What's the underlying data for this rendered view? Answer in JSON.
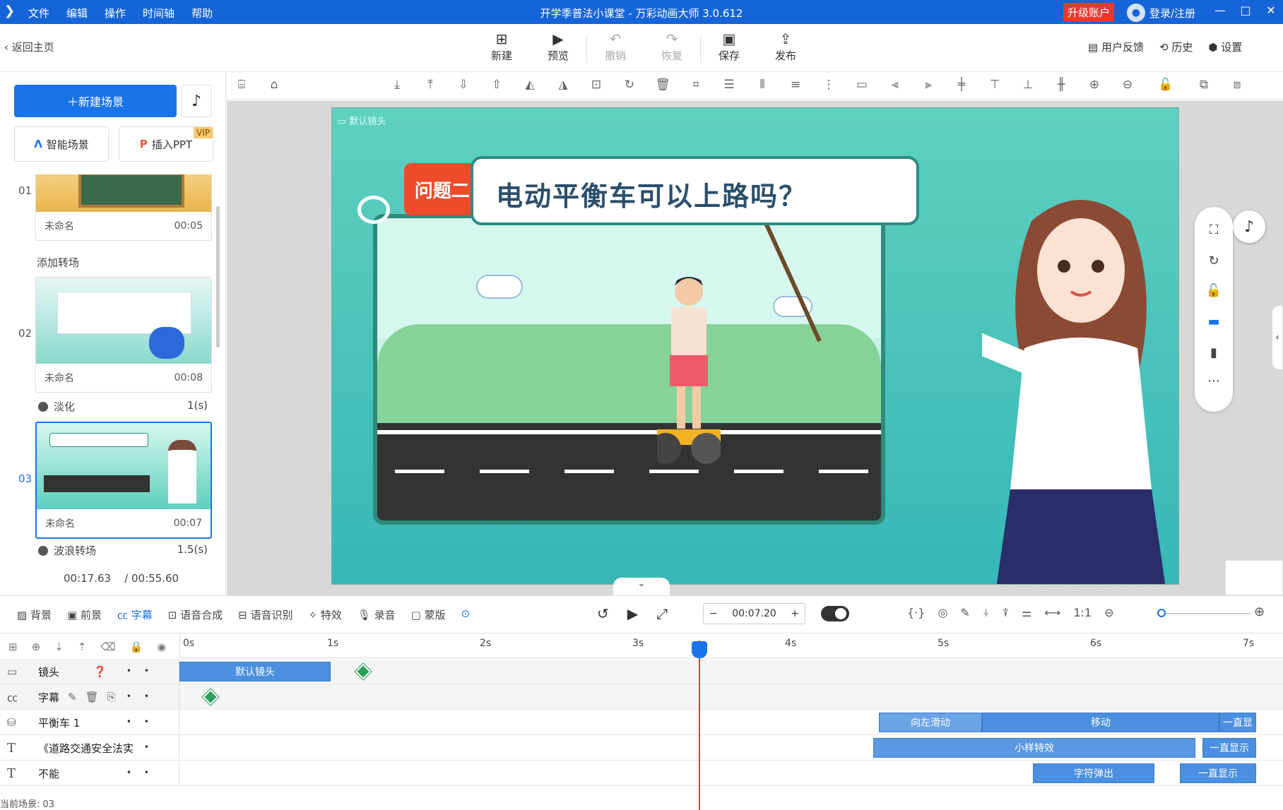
{
  "menu": [
    "文件",
    "编辑",
    "操作",
    "时间轴",
    "帮助"
  ],
  "app_title": "开学季普法小课堂 - 万彩动画大师 3.0.612",
  "upgrade": "升级账户",
  "login": "登录/注册",
  "back": "返回主页",
  "toolbar": [
    {
      "label": "新建",
      "icon": "plus-square-icon",
      "disabled": false
    },
    {
      "label": "预览",
      "icon": "play-icon",
      "disabled": false
    },
    {
      "label": "撤销",
      "icon": "undo-icon",
      "disabled": true
    },
    {
      "label": "恢复",
      "icon": "redo-icon",
      "disabled": true
    },
    {
      "label": "保存",
      "icon": "save-icon",
      "disabled": false
    },
    {
      "label": "发布",
      "icon": "publish-icon",
      "disabled": false
    }
  ],
  "right_actions": [
    "用户反馈",
    "历史",
    "设置"
  ],
  "new_scene": "新建场景",
  "smart_scene": "智能场景",
  "insert_ppt": "插入PPT",
  "vip": "VIP",
  "add_transition": "添加转场",
  "scenes": [
    {
      "num": "01",
      "name": "未命名",
      "dur": "00:05"
    },
    {
      "num": "02",
      "name": "未命名",
      "dur": "00:08"
    },
    {
      "num": "03",
      "name": "未命名",
      "dur": "00:07"
    }
  ],
  "transitions": [
    {
      "name": "淡化",
      "dur": "1(s)"
    },
    {
      "name": "波浪转场",
      "dur": "1.5(s)"
    }
  ],
  "current_time": "00:17.63",
  "total_time": "/ 00:55.60",
  "canvas": {
    "camera_label": "默认镜头",
    "badge": "问题二:",
    "question": "电动平衡车可以上路吗？"
  },
  "bottom_tabs": [
    "背景",
    "前景",
    "字幕",
    "语音合成",
    "语音识别",
    "特效",
    "录音",
    "蒙版"
  ],
  "time_value": "00:07.20",
  "ruler": [
    "0s",
    "1s",
    "2s",
    "3s",
    "4s",
    "5s",
    "6s",
    "7s"
  ],
  "tracks": [
    {
      "label": "镜头",
      "clips": [
        "默认镜头"
      ]
    },
    {
      "label": "字幕",
      "clips": []
    },
    {
      "label": "平衡车 1",
      "clips": [
        "向左滑动",
        "移动",
        "一直显"
      ]
    },
    {
      "label": "《道路交通安全法实",
      "clips": [
        "小样特效",
        "一直显示"
      ]
    },
    {
      "label": "不能",
      "clips": [
        "字符弹出",
        "一直显示"
      ]
    }
  ],
  "status": "当前场景: 03",
  "colors": {
    "accent": "#1a73e8",
    "title_bar": "#1565d8",
    "upgrade": "#e53935",
    "playhead": "#e53935"
  }
}
